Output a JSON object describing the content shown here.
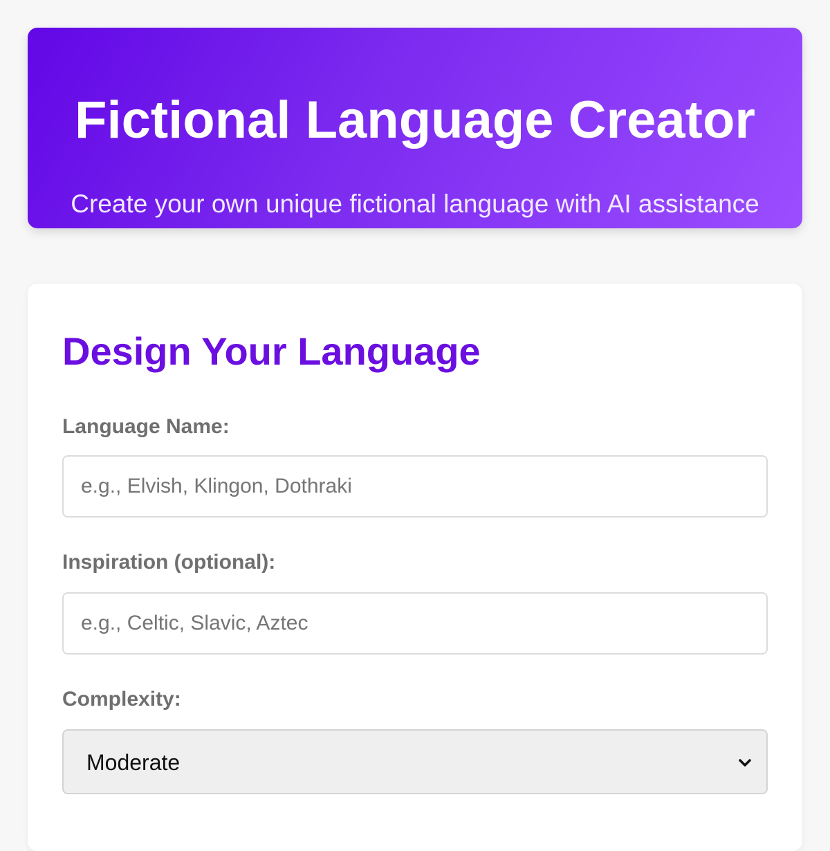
{
  "header": {
    "title": "Fictional Language Creator",
    "subtitle": "Create your own unique fictional language with AI assistance"
  },
  "form": {
    "heading": "Design Your Language",
    "language_name": {
      "label": "Language Name:",
      "value": "",
      "placeholder": "e.g., Elvish, Klingon, Dothraki"
    },
    "inspiration": {
      "label": "Inspiration (optional):",
      "value": "",
      "placeholder": "e.g., Celtic, Slavic, Aztec"
    },
    "complexity": {
      "label": "Complexity:",
      "selected": "Moderate"
    }
  },
  "colors": {
    "header_gradient_start": "#6207e6",
    "header_gradient_end": "#9b4dff",
    "heading_accent": "#6a0fe0",
    "page_background": "#f7f7f7"
  },
  "icons": {
    "select_arrow": "chevron-down-icon"
  }
}
